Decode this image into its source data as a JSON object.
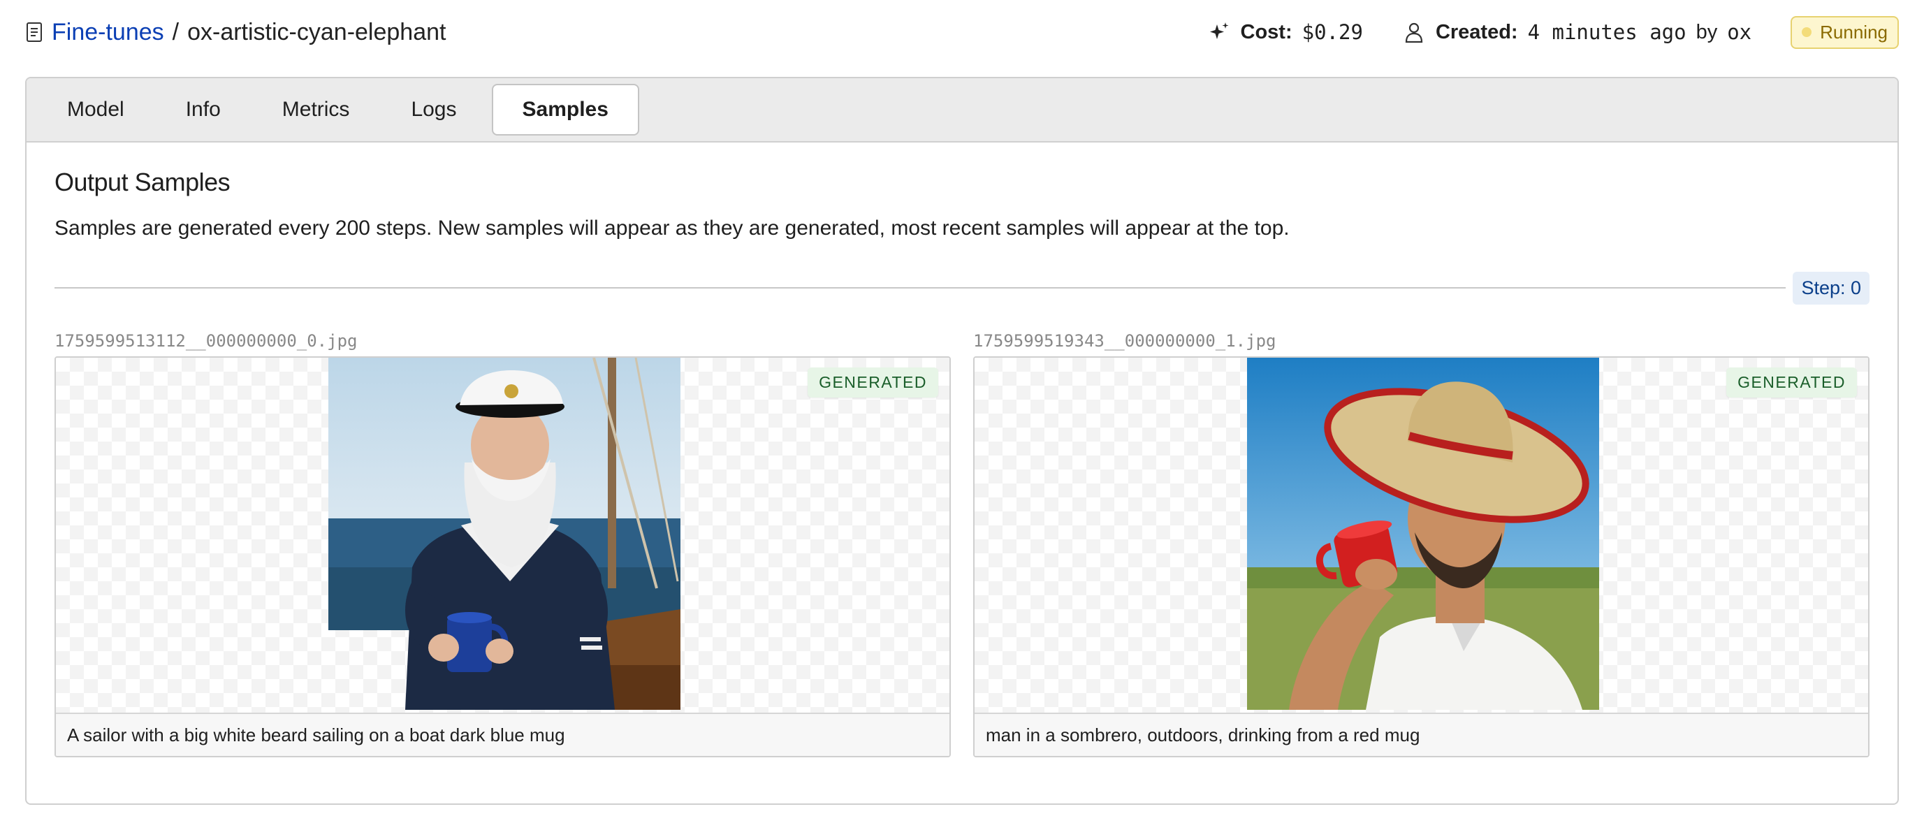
{
  "breadcrumb": {
    "parent": "Fine-tunes",
    "separator": "/",
    "current": "ox-artistic-cyan-elephant"
  },
  "meta": {
    "cost_label": "Cost:",
    "cost_value": "$0.29",
    "created_label": "Created:",
    "created_value": "4 minutes ago",
    "created_by": "by",
    "created_user": "ox",
    "status": "Running"
  },
  "tabs": [
    {
      "label": "Model"
    },
    {
      "label": "Info"
    },
    {
      "label": "Metrics"
    },
    {
      "label": "Logs"
    },
    {
      "label": "Samples",
      "active": true
    }
  ],
  "section": {
    "title": "Output Samples",
    "description": "Samples are generated every 200 steps. New samples will appear as they are generated, most recent samples will appear at the top."
  },
  "step_label": "Step: 0",
  "samples": [
    {
      "filename": "1759599513112__000000000_0.jpg",
      "badge": "GENERATED",
      "caption": "A sailor with a big white beard sailing on a boat dark blue mug"
    },
    {
      "filename": "1759599519343__000000000_1.jpg",
      "badge": "GENERATED",
      "caption": "man in a sombrero, outdoors, drinking from a red mug"
    }
  ],
  "colors": {
    "link": "#0b3fb4",
    "status_bg": "#fdf6cf",
    "badge_bg": "#e7f5e7",
    "step_bg": "#e6eef8"
  },
  "icons": {
    "breadcrumb": "document-icon",
    "cost": "sparkle-icon",
    "created": "user-icon",
    "status": "status-dot-icon"
  }
}
